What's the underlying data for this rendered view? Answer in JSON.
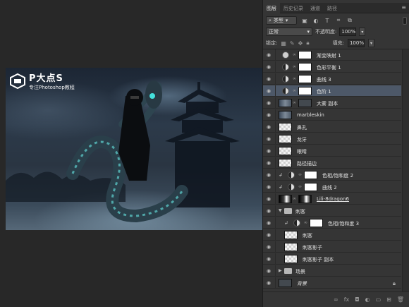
{
  "watermark": {
    "title": "P大点S",
    "subtitle": "专注Photoshop教程",
    "icon": "logo-icon"
  },
  "panel": {
    "tabs": [
      "图层",
      "历史记录",
      "通道",
      "路径"
    ],
    "active_tab": "图层",
    "filter_kind": "类型",
    "blend_mode": "正常",
    "opacity_label": "不透明度:",
    "opacity_value": "100%",
    "lock_label": "锁定:",
    "fill_label": "填充:",
    "fill_value": "100%"
  },
  "layers": [
    {
      "name": "渐变映射 1",
      "type": "adjustment"
    },
    {
      "name": "色彩平衡 1",
      "type": "adjustment"
    },
    {
      "name": "曲线 3",
      "type": "adjustment"
    },
    {
      "name": "色阶 1",
      "type": "adjustment",
      "selected": true
    },
    {
      "name": "大雾 副本",
      "type": "masked-photo"
    },
    {
      "name": "marbleskin",
      "type": "photo"
    },
    {
      "name": "鼻孔",
      "type": "transparent"
    },
    {
      "name": "龙牙",
      "type": "transparent"
    },
    {
      "name": "眼睛",
      "type": "transparent"
    },
    {
      "name": "路径描边",
      "type": "transparent"
    },
    {
      "name": "色相/饱和度 2",
      "type": "clipped-adjustment"
    },
    {
      "name": "曲线 2",
      "type": "clipped-adjustment"
    },
    {
      "name": "Lili-8dragon6",
      "type": "smart-dragon"
    },
    {
      "name": "刺客",
      "type": "group-open"
    },
    {
      "name": "色相/饱和度 3",
      "type": "clipped-adjustment-nested"
    },
    {
      "name": "刺客",
      "type": "nested-layer"
    },
    {
      "name": "刺客影子",
      "type": "nested-layer"
    },
    {
      "name": "刺客影子 副本",
      "type": "nested-layer"
    },
    {
      "name": "场景",
      "type": "group-closed"
    },
    {
      "name": "背景",
      "type": "background"
    }
  ]
}
